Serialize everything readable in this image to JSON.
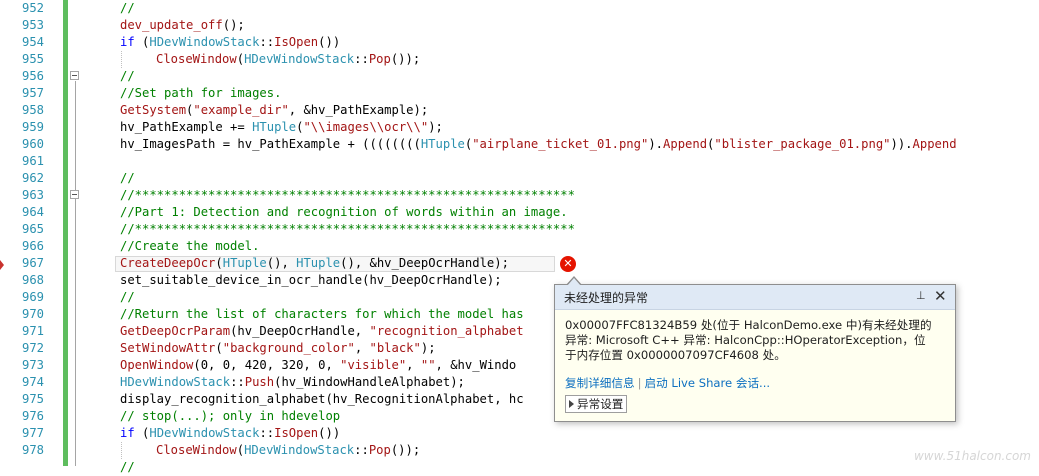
{
  "editor": {
    "lines": [
      {
        "num": "952",
        "tokens": [
          {
            "c": "c",
            "t": "//"
          }
        ]
      },
      {
        "num": "953",
        "tokens": [
          {
            "c": "f",
            "t": "dev_update_off"
          },
          {
            "c": "",
            "t": "();"
          }
        ]
      },
      {
        "num": "954",
        "tokens": [
          {
            "c": "k",
            "t": "if"
          },
          {
            "c": "",
            "t": " ("
          },
          {
            "c": "t",
            "t": "HDevWindowStack"
          },
          {
            "c": "",
            "t": "::"
          },
          {
            "c": "f",
            "t": "IsOpen"
          },
          {
            "c": "",
            "t": "())"
          }
        ]
      },
      {
        "num": "955",
        "indent": 1,
        "tokens": [
          {
            "c": "f",
            "t": "CloseWindow"
          },
          {
            "c": "",
            "t": "("
          },
          {
            "c": "t",
            "t": "HDevWindowStack"
          },
          {
            "c": "",
            "t": "::"
          },
          {
            "c": "f",
            "t": "Pop"
          },
          {
            "c": "",
            "t": "());"
          }
        ]
      },
      {
        "num": "956",
        "tokens": [
          {
            "c": "c",
            "t": "//"
          }
        ]
      },
      {
        "num": "957",
        "tokens": [
          {
            "c": "c",
            "t": "//Set path for images."
          }
        ]
      },
      {
        "num": "958",
        "tokens": [
          {
            "c": "f",
            "t": "GetSystem"
          },
          {
            "c": "",
            "t": "("
          },
          {
            "c": "s",
            "t": "\"example_dir\""
          },
          {
            "c": "",
            "t": ", &hv_PathExample);"
          }
        ]
      },
      {
        "num": "959",
        "tokens": [
          {
            "c": "",
            "t": "hv_PathExample += "
          },
          {
            "c": "t",
            "t": "HTuple"
          },
          {
            "c": "",
            "t": "("
          },
          {
            "c": "s",
            "t": "\"\\\\images\\\\ocr\\\\\""
          },
          {
            "c": "",
            "t": ");"
          }
        ]
      },
      {
        "num": "960",
        "tokens": [
          {
            "c": "",
            "t": "hv_ImagesPath = hv_PathExample + (((((((("
          },
          {
            "c": "t",
            "t": "HTuple"
          },
          {
            "c": "",
            "t": "("
          },
          {
            "c": "s",
            "t": "\"airplane_ticket_01.png\""
          },
          {
            "c": "",
            "t": ")."
          },
          {
            "c": "f",
            "t": "Append"
          },
          {
            "c": "",
            "t": "("
          },
          {
            "c": "s",
            "t": "\"blister_package_01.png\""
          },
          {
            "c": "",
            "t": "))."
          },
          {
            "c": "f",
            "t": "Append"
          }
        ]
      },
      {
        "num": "961",
        "tokens": []
      },
      {
        "num": "962",
        "tokens": [
          {
            "c": "c",
            "t": "//"
          }
        ]
      },
      {
        "num": "963",
        "tokens": [
          {
            "c": "c",
            "t": "//************************************************************"
          }
        ]
      },
      {
        "num": "964",
        "tokens": [
          {
            "c": "c",
            "t": "//Part 1: Detection and recognition of words within an image."
          }
        ]
      },
      {
        "num": "965",
        "tokens": [
          {
            "c": "c",
            "t": "//************************************************************"
          }
        ]
      },
      {
        "num": "966",
        "tokens": [
          {
            "c": "c",
            "t": "//Create the model."
          }
        ]
      },
      {
        "num": "967",
        "tokens": [
          {
            "c": "f",
            "t": "CreateDeepOcr"
          },
          {
            "c": "",
            "t": "("
          },
          {
            "c": "t",
            "t": "HTuple"
          },
          {
            "c": "",
            "t": "(), "
          },
          {
            "c": "t",
            "t": "HTuple"
          },
          {
            "c": "",
            "t": "(), &hv_DeepOcrHandle);"
          }
        ]
      },
      {
        "num": "968",
        "tokens": [
          {
            "c": "",
            "t": "set_suitable_device_in_ocr_handle(hv_DeepOcrHandle);"
          }
        ]
      },
      {
        "num": "969",
        "tokens": [
          {
            "c": "c",
            "t": "//"
          }
        ]
      },
      {
        "num": "970",
        "tokens": [
          {
            "c": "c",
            "t": "//Return the list of characters for which the model has"
          }
        ]
      },
      {
        "num": "971",
        "tokens": [
          {
            "c": "f",
            "t": "GetDeepOcrParam"
          },
          {
            "c": "",
            "t": "(hv_DeepOcrHandle, "
          },
          {
            "c": "s",
            "t": "\"recognition_alphabet"
          }
        ]
      },
      {
        "num": "972",
        "tokens": [
          {
            "c": "f",
            "t": "SetWindowAttr"
          },
          {
            "c": "",
            "t": "("
          },
          {
            "c": "s",
            "t": "\"background_color\""
          },
          {
            "c": "",
            "t": ", "
          },
          {
            "c": "s",
            "t": "\"black\""
          },
          {
            "c": "",
            "t": ");"
          }
        ]
      },
      {
        "num": "973",
        "tokens": [
          {
            "c": "f",
            "t": "OpenWindow"
          },
          {
            "c": "",
            "t": "(0, 0, 420, 320, 0, "
          },
          {
            "c": "s",
            "t": "\"visible\""
          },
          {
            "c": "",
            "t": ", "
          },
          {
            "c": "s",
            "t": "\"\""
          },
          {
            "c": "",
            "t": ", &hv_Windo"
          }
        ]
      },
      {
        "num": "974",
        "tokens": [
          {
            "c": "t",
            "t": "HDevWindowStack"
          },
          {
            "c": "",
            "t": "::"
          },
          {
            "c": "f",
            "t": "Push"
          },
          {
            "c": "",
            "t": "(hv_WindowHandleAlphabet);"
          }
        ]
      },
      {
        "num": "975",
        "tokens": [
          {
            "c": "",
            "t": "display_recognition_alphabet(hv_RecognitionAlphabet, hc"
          }
        ]
      },
      {
        "num": "976",
        "tokens": [
          {
            "c": "c",
            "t": "// stop(...); only in hdevelop"
          }
        ]
      },
      {
        "num": "977",
        "tokens": [
          {
            "c": "k",
            "t": "if"
          },
          {
            "c": "",
            "t": " ("
          },
          {
            "c": "t",
            "t": "HDevWindowStack"
          },
          {
            "c": "",
            "t": "::"
          },
          {
            "c": "f",
            "t": "IsOpen"
          },
          {
            "c": "",
            "t": "())"
          }
        ]
      },
      {
        "num": "978",
        "indent": 1,
        "tokens": [
          {
            "c": "f",
            "t": "CloseWindow"
          },
          {
            "c": "",
            "t": "("
          },
          {
            "c": "t",
            "t": "HDevWindowStack"
          },
          {
            "c": "",
            "t": "::"
          },
          {
            "c": "f",
            "t": "Pop"
          },
          {
            "c": "",
            "t": "());"
          }
        ]
      },
      {
        "num": "",
        "tokens": [
          {
            "c": "c",
            "t": "//"
          }
        ]
      }
    ]
  },
  "exception_popup": {
    "title": "未经处理的异常",
    "pin_icon": "pin-icon",
    "close_icon": "close-icon",
    "message_line1": "0x00007FFC81324B59 处(位于 HalconDemo.exe 中)有未经处理的",
    "message_line2": "异常: Microsoft C++ 异常: HalconCpp::HOperatorException，位",
    "message_line3": "于内存位置 0x0000007097CF4608 处。",
    "link_copy": "复制详细信息",
    "separator": "|",
    "link_liveshare": "启动 Live Share 会话...",
    "settings_label": "异常设置"
  },
  "error_icon": "error-x-icon",
  "watermark": "www.51halcon.com",
  "colors": {
    "keyword": "#0000ff",
    "function": "#a31515",
    "type": "#2b91af",
    "comment": "#008000",
    "error": "#e51400",
    "change_margin": "#5ebd5e"
  }
}
